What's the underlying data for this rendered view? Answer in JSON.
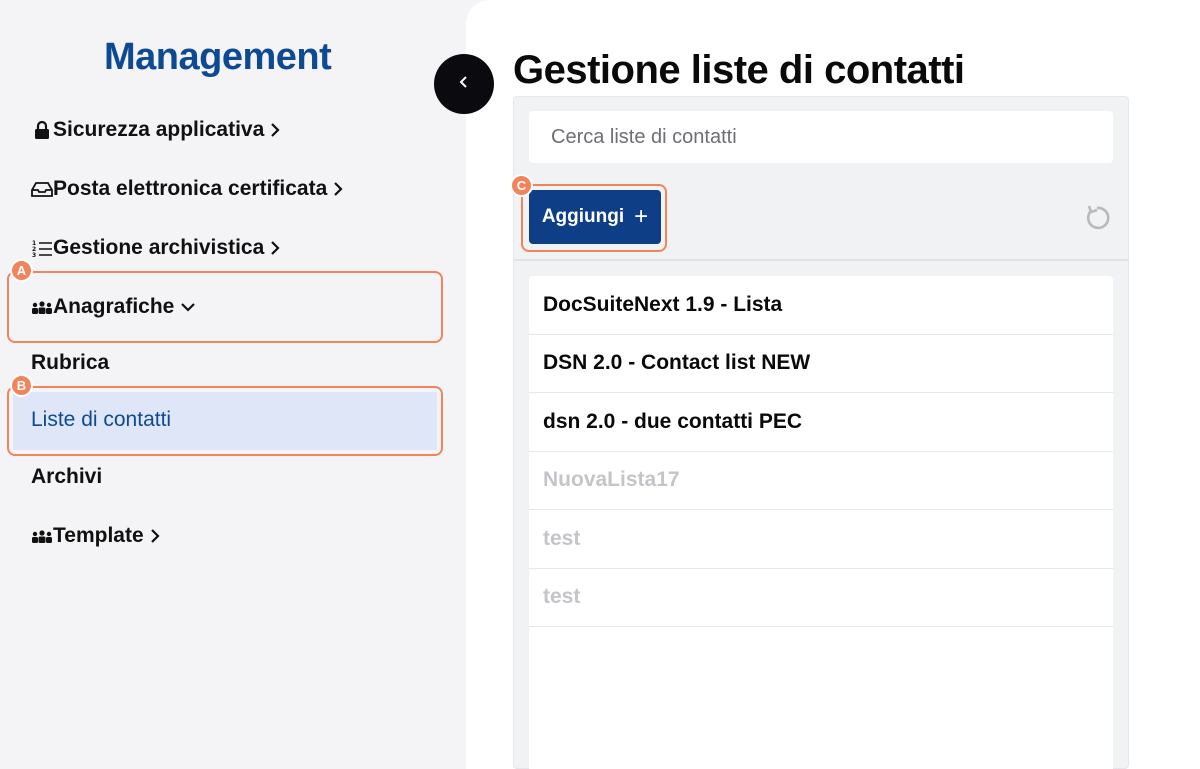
{
  "sidebar": {
    "brand": "Management",
    "items": [
      {
        "label": "Sicurezza applicativa",
        "icon": "lock-icon",
        "chevron": "chevron-right-icon"
      },
      {
        "label": "Posta elettronica certificata",
        "icon": "inbox-tray-icon",
        "chevron": "chevron-right-icon"
      },
      {
        "label": "Gestione archivistica",
        "icon": "numbered-list-icon",
        "chevron": "chevron-right-icon"
      },
      {
        "label": "Anagrafiche",
        "icon": "people-group-icon",
        "chevron": "chevron-down-icon",
        "expanded": true
      }
    ],
    "sub_items": [
      {
        "label": "Rubrica"
      },
      {
        "label": "Liste di contatti",
        "active": true
      },
      {
        "label": "Archivi"
      }
    ],
    "template_item": {
      "label": "Template",
      "icon": "people-group-icon",
      "chevron": "chevron-right-icon"
    }
  },
  "collapse_button": {
    "icon": "chevron-left-icon"
  },
  "main": {
    "title": "Gestione liste di contatti",
    "search": {
      "placeholder": "Cerca liste di contatti",
      "value": ""
    },
    "add_button": {
      "label": "Aggiungi",
      "icon": "plus-icon"
    },
    "refresh_button": {
      "icon": "refresh-icon"
    },
    "lists": [
      {
        "name": "DocSuiteNext 1.9 - Lista",
        "disabled": false
      },
      {
        "name": "DSN 2.0 - Contact list NEW",
        "disabled": false
      },
      {
        "name": "dsn 2.0 - due contatti PEC",
        "disabled": false
      },
      {
        "name": "NuovaLista17",
        "disabled": true
      },
      {
        "name": "test",
        "disabled": true
      },
      {
        "name": "test",
        "disabled": true
      }
    ]
  },
  "annotations": {
    "a": "A",
    "b": "B",
    "c": "C",
    "color": "#f2845c"
  },
  "colors": {
    "brand": "#0e4a94",
    "primary_button": "#0e3f86",
    "active_item_bg": "#dfe6f7",
    "annotation": "#f2845c"
  }
}
